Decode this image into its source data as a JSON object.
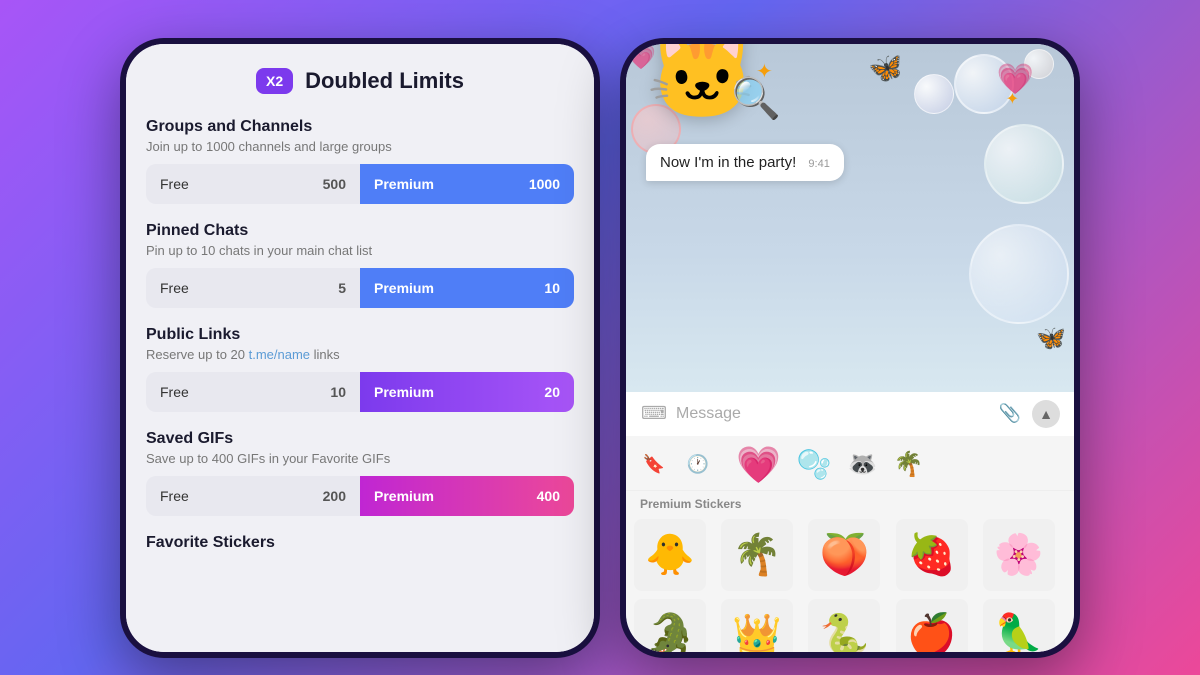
{
  "header": {
    "badge": "X2",
    "title": "Doubled Limits"
  },
  "sections": [
    {
      "id": "groups-channels",
      "title": "Groups and Channels",
      "desc": "Join up to 1000 channels and large groups",
      "free_val": "500",
      "premium_val": "1000",
      "premium_type": "blue"
    },
    {
      "id": "pinned-chats",
      "title": "Pinned Chats",
      "desc": "Pin up to 10 chats in your main chat list",
      "free_val": "5",
      "premium_val": "10",
      "premium_type": "blue"
    },
    {
      "id": "public-links",
      "title": "Public Links",
      "desc_plain": "Reserve up to 20 ",
      "desc_link": "t.me/name",
      "desc_suffix": " links",
      "free_val": "10",
      "premium_val": "20",
      "premium_type": "purple"
    },
    {
      "id": "saved-gifs",
      "title": "Saved GIFs",
      "desc": "Save up to 400 GIFs in your Favorite GIFs",
      "free_val": "200",
      "premium_val": "400",
      "premium_type": "pink"
    }
  ],
  "bottom_section": "Favorite Stickers",
  "labels": {
    "free": "Free",
    "premium": "Premium"
  },
  "chat": {
    "message_placeholder": "Message",
    "bubble_text": "Now I'm in the party!",
    "bubble_time": "9:41",
    "sticker_section": "Premium Stickers"
  }
}
